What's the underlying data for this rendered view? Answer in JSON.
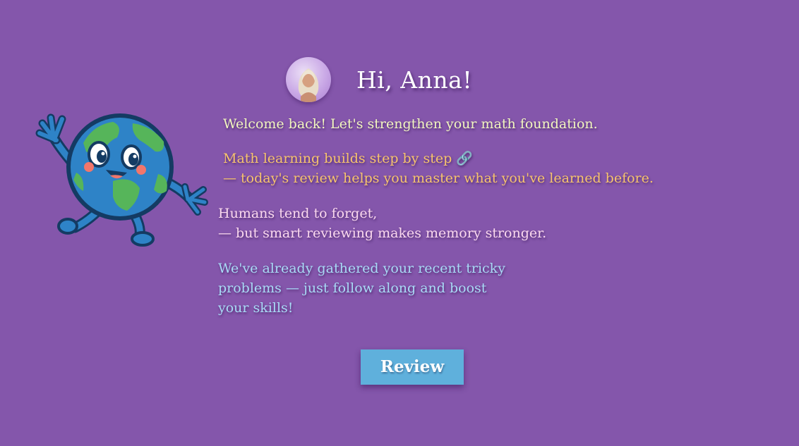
{
  "header": {
    "greeting": "Hi,  Anna!"
  },
  "messages": {
    "welcome": "Welcome back! Let's strengthen your math foundation.",
    "math_line1": "Math learning builds step by step 🔗",
    "math_line2": "— today's review helps you master what you've learned before.",
    "humans_line1": "Humans tend to forget,",
    "humans_line2": "— but smart reviewing makes memory stronger.",
    "gathered_line1": "We've already gathered your recent tricky",
    "gathered_line2": "problems — just follow along and boost",
    "gathered_line3": "your skills!"
  },
  "actions": {
    "review_label": "Review"
  },
  "icons": {
    "avatar": "user-avatar-icon",
    "mascot": "earth-mascot-icon"
  },
  "colors": {
    "background": "#8456ab",
    "welcome_text": "#f2f7bf",
    "math_text": "#f7c46d",
    "humans_text": "#fbd9ef",
    "gathered_text": "#a9dbf6",
    "button": "#5fb0dc"
  }
}
